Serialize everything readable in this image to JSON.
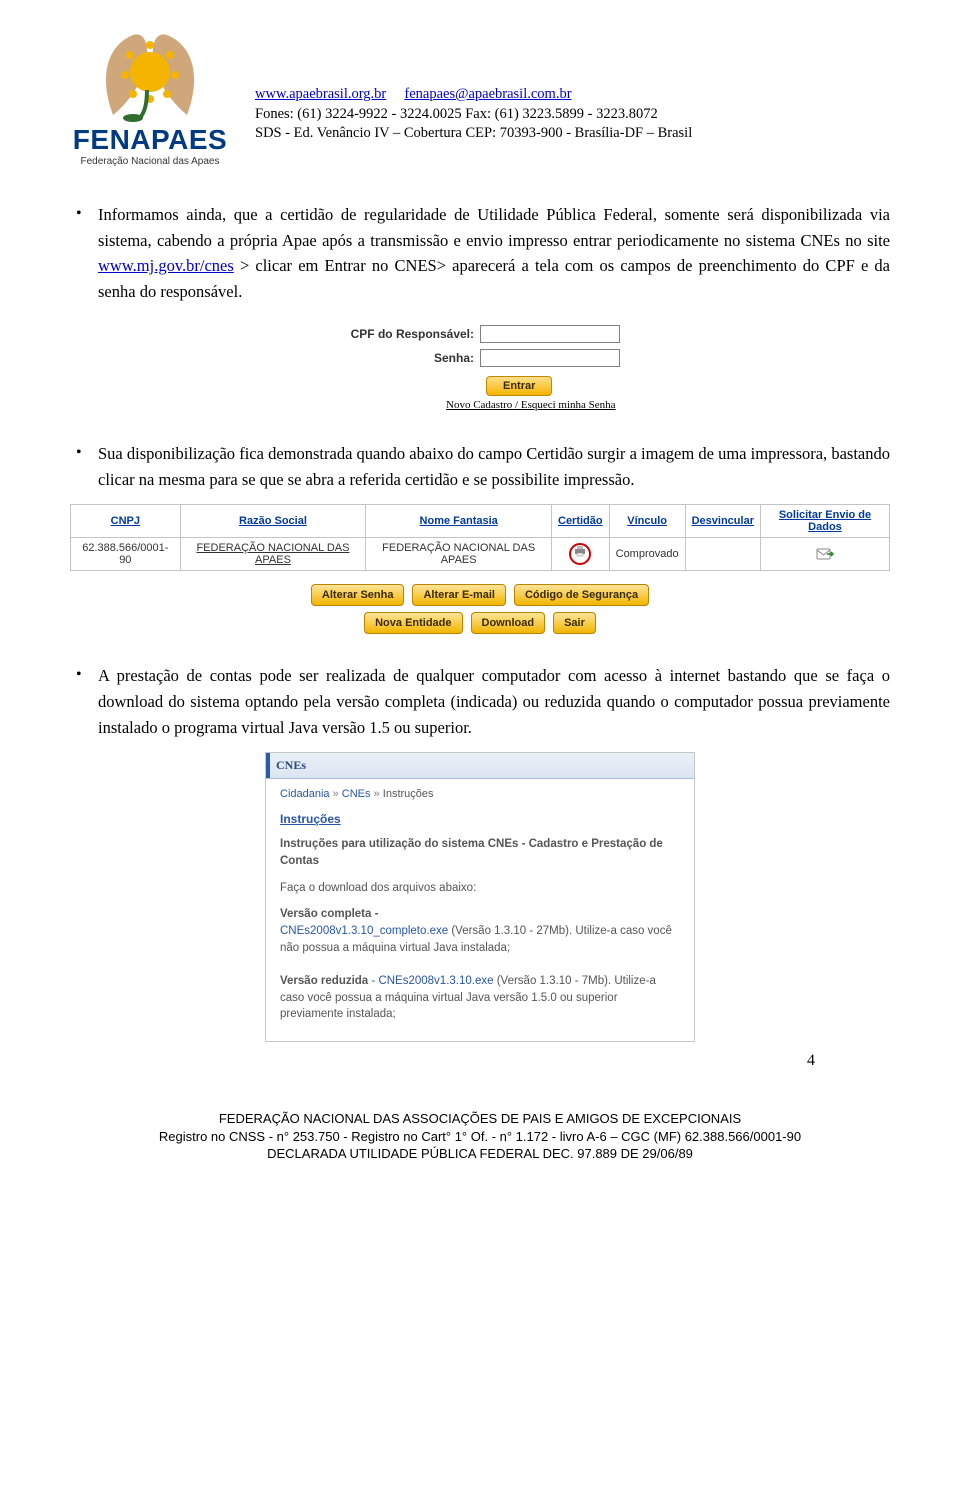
{
  "header": {
    "brand": "FENAPAES",
    "brand_sub": "Federação Nacional das Apaes",
    "contact_line1_a": "www.apaebrasil.org.br",
    "contact_line1_b": "fenapaes@apaebrasil.com.br",
    "contact_line2": "Fones: (61) 3224-9922 - 3224.0025 Fax: (61) 3223.5899 - 3223.8072",
    "contact_line3": "SDS - Ed. Venâncio IV – Cobertura CEP: 70393-900 - Brasília-DF – Brasil"
  },
  "bullets": {
    "b1a": "Informamos ainda, que a certidão de regularidade de Utilidade Pública Federal, somente será disponibilizada via sistema, cabendo a própria Apae após a transmissão e envio impresso entrar periodicamente no sistema CNEs no site ",
    "b1_link": "www.mj.gov.br/cnes",
    "b1b": " > clicar em Entrar no CNES> aparecerá a tela com os campos de preenchimento do CPF e da senha do responsável.",
    "b2": "Sua disponibilização fica demonstrada  quando abaixo do campo Certidão surgir a imagem de uma impressora, bastando clicar na mesma para se que se abra a referida certidão e se possibilite impressão.",
    "b3": "A prestação de contas pode ser realizada de qualquer computador com acesso à internet bastando que se faça o download do sistema optando pela versão completa (indicada) ou reduzida quando o computador possua previamente instalado o programa virtual Java versão 1.5 ou superior."
  },
  "login": {
    "cpf_label": "CPF do Responsável:",
    "senha_label": "Senha:",
    "entrar": "Entrar",
    "novo": "Novo Cadastro",
    "sep": " / ",
    "esqueci": "Esqueci minha Senha"
  },
  "table": {
    "h_cnpj": "CNPJ",
    "h_razao": "Razão Social",
    "h_nome": "Nome Fantasia",
    "h_cert": "Certidão",
    "h_vinc": "Vínculo",
    "h_desv": "Desvincular",
    "h_env": "Solicitar Envio de Dados",
    "cnpj": "62.388.566/0001-90",
    "razao": "FEDERAÇÃO NACIONAL DAS APAES",
    "nome": "FEDERAÇÃO NACIONAL DAS APAES",
    "vinc": "Comprovado"
  },
  "buttons": {
    "b1": "Alterar Senha",
    "b2": "Alterar E-mail",
    "b3": "Código de Segurança",
    "b4": "Nova Entidade",
    "b5": "Download",
    "b6": "Sair"
  },
  "instr": {
    "head": "CNEs",
    "bc1": "Cidadania",
    "bc2": "CNEs",
    "bc3": "Instruções",
    "title": "Instruções",
    "sub": "Instruções para utilização do sistema CNEs - Cadastro e Prestação de Contas",
    "intro": "Faça o download dos arquivos abaixo:",
    "vc_label": "Versão completa",
    "vc_sep": " - ",
    "vc_file": "CNEs2008v1.3.10_completo.exe",
    "vc_info": " (Versão 1.3.10 - 27Mb). Utilize-a caso você não possua a máquina virtual Java instalada;",
    "vr_label": "Versão reduzida",
    "vr_file": " - CNEs2008v1.3.10.exe",
    "vr_info": " (Versão 1.3.10 - 7Mb). Utilize-a caso você possua a máquina virtual Java versão 1.5.0 ou superior previamente instalada;"
  },
  "page_num": "4",
  "footer": {
    "l1": "FEDERAÇÃO NACIONAL DAS ASSOCIAÇÕES DE PAIS E AMIGOS DE EXCEPCIONAIS",
    "l2": "Registro no CNSS - n° 253.750 - Registro no Cart° 1° Of. - n° 1.172 - livro A-6 – CGC (MF) 62.388.566/0001-90",
    "l3": "DECLARADA UTILIDADE PÚBLICA FEDERAL DEC. 97.889 DE 29/06/89"
  }
}
